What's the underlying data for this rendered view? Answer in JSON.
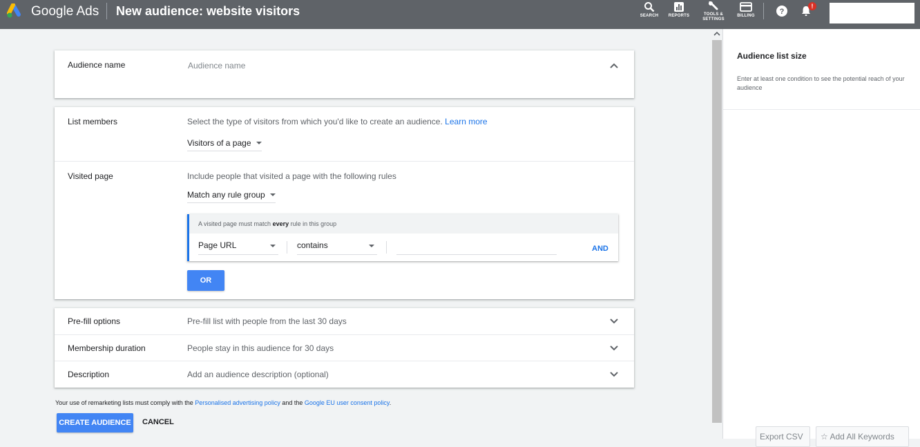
{
  "header": {
    "brand": "Google Ads",
    "title": "New audience: website visitors",
    "tools": [
      {
        "label": "SEARCH",
        "icon": "search-icon"
      },
      {
        "label": "REPORTS",
        "icon": "reports-icon"
      },
      {
        "label": "TOOLS &",
        "label2": "SETTINGS",
        "icon": "wrench-icon"
      },
      {
        "label": "BILLING",
        "icon": "credit-card-icon"
      }
    ],
    "help_icon": "help-icon",
    "notifications_icon": "bell-icon",
    "notification_badge": "!"
  },
  "audience_name": {
    "label": "Audience name",
    "placeholder": "Audience name"
  },
  "list_members": {
    "label": "List members",
    "hint": "Select the type of visitors from which you'd like to create an audience.",
    "learn_more": "Learn more",
    "selected": "Visitors of a page"
  },
  "visited_page": {
    "label": "Visited page",
    "hint": "Include people that visited a page with the following rules",
    "match_selected": "Match any rule group",
    "rule_group": {
      "head_prefix": "A visited page must match ",
      "head_bold": "every",
      "head_suffix": " rule in this group",
      "field": "Page URL",
      "operator": "contains",
      "value": "",
      "and_label": "AND"
    },
    "or_label": "OR"
  },
  "options": [
    {
      "label": "Pre-fill options",
      "value": "Pre-fill list with people from the last 30 days"
    },
    {
      "label": "Membership duration",
      "value": "People stay in this audience for 30 days"
    },
    {
      "label": "Description",
      "value": "Add an audience description (optional)"
    }
  ],
  "footer": {
    "policy_prefix": "Your use of remarketing lists must comply with the ",
    "policy_link1": "Personalised advertising policy",
    "policy_mid": " and the ",
    "policy_link2": "Google EU user consent policy",
    "policy_suffix": ".",
    "create_label": "CREATE AUDIENCE",
    "cancel_label": "CANCEL"
  },
  "side_panel": {
    "title": "Audience list size",
    "text": "Enter at least one condition to see the potential reach of your audience",
    "export_label": "Export CSV",
    "add_keywords_label": "Add All Keywords"
  },
  "colors": {
    "topbar": "#5f6368",
    "primary": "#4285f4",
    "link": "#1a73e8",
    "badge": "#d93025"
  }
}
